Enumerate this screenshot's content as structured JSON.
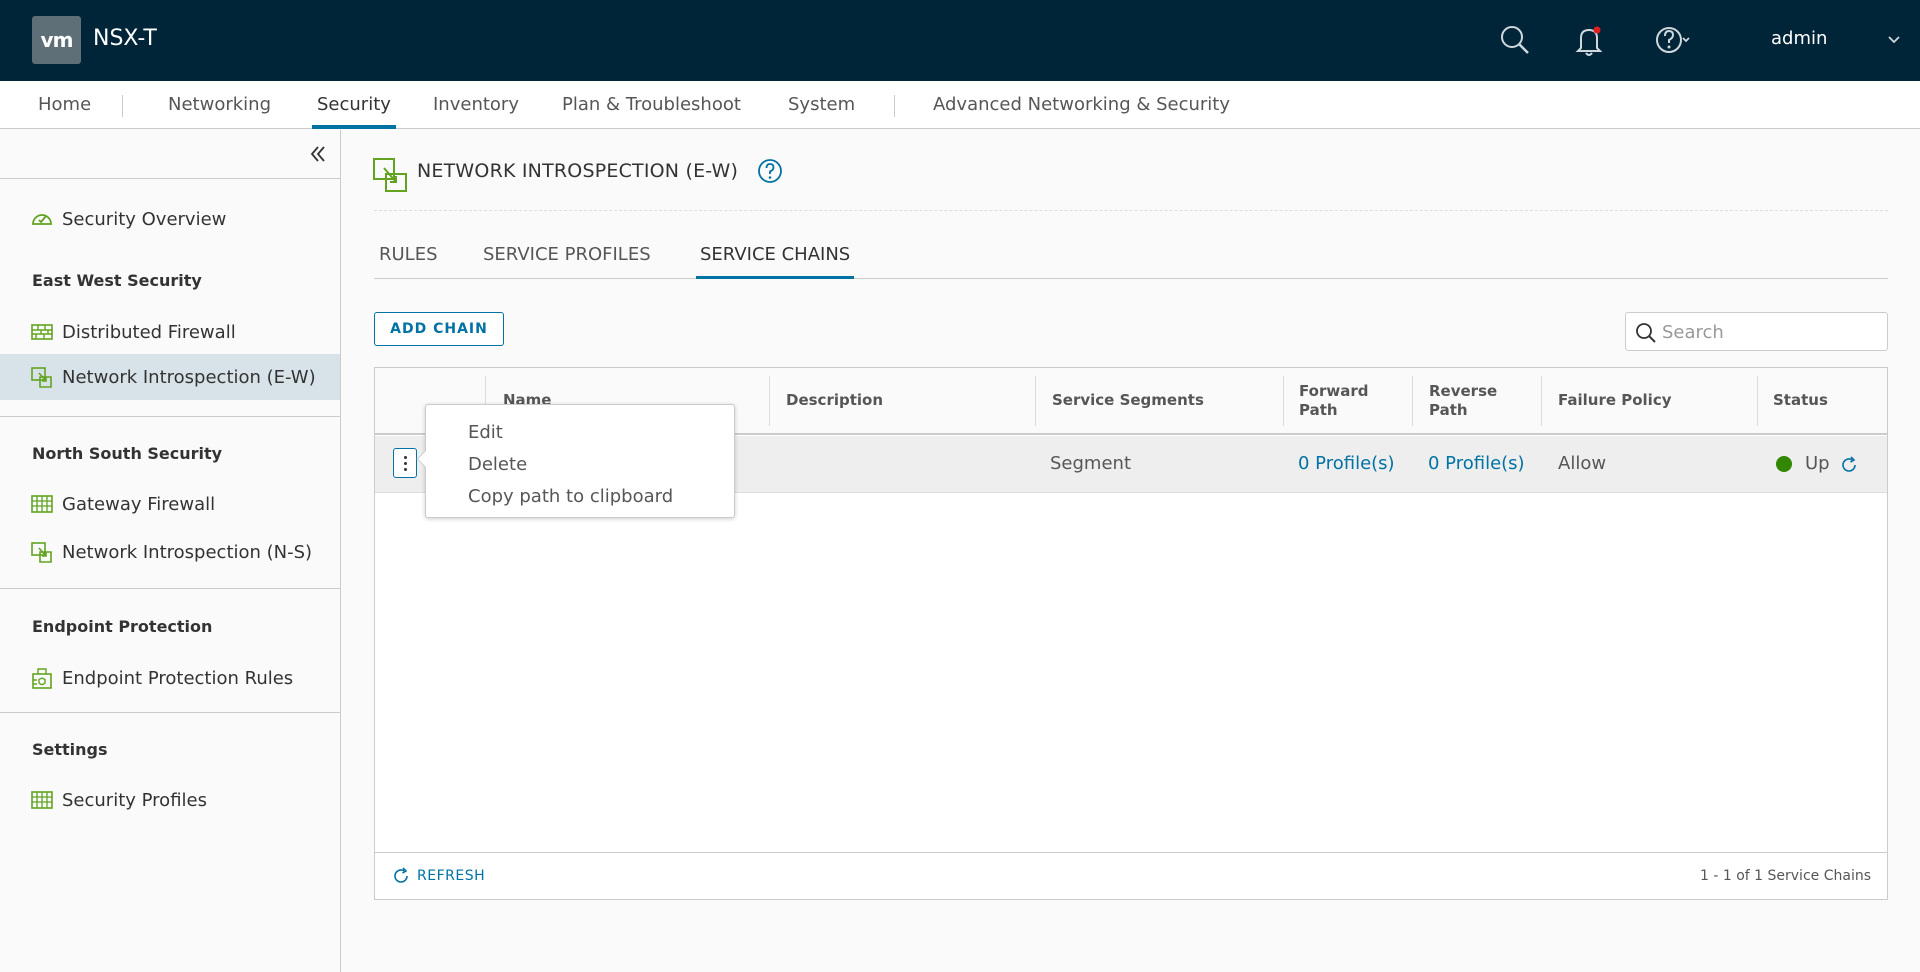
{
  "header": {
    "logo_text": "vm",
    "brand": "NSX-T",
    "user": "admin",
    "icons": [
      "search-icon",
      "bell-icon",
      "help-icon",
      "chevron-down-icon"
    ],
    "colors": {
      "background": "#002538",
      "notification_dot": "#e02020"
    }
  },
  "nav": {
    "items": [
      {
        "label": "Home"
      },
      {
        "label": "Networking"
      },
      {
        "label": "Security",
        "active": true
      },
      {
        "label": "Inventory"
      },
      {
        "label": "Plan & Troubleshoot"
      },
      {
        "label": "System"
      },
      {
        "label": "Advanced Networking & Security"
      }
    ],
    "accent": "#0072a3"
  },
  "sidebar": {
    "overview": {
      "label": "Security Overview",
      "icon": "gauge-icon"
    },
    "sections": [
      {
        "heading": "East West Security",
        "items": [
          {
            "label": "Distributed Firewall",
            "icon": "firewall-icon"
          },
          {
            "label": "Network Introspection (E-W)",
            "icon": "introspection-icon",
            "active": true
          }
        ]
      },
      {
        "heading": "North South Security",
        "items": [
          {
            "label": "Gateway Firewall",
            "icon": "gateway-firewall-icon"
          },
          {
            "label": "Network Introspection (N-S)",
            "icon": "introspection-icon"
          }
        ]
      },
      {
        "heading": "Endpoint Protection",
        "items": [
          {
            "label": "Endpoint Protection Rules",
            "icon": "endpoint-icon"
          }
        ]
      },
      {
        "heading": "Settings",
        "items": [
          {
            "label": "Security Profiles",
            "icon": "profiles-icon"
          }
        ]
      }
    ],
    "icon_color": "#62a420"
  },
  "main": {
    "title": "NETWORK INTROSPECTION (E-W)",
    "tabs": [
      {
        "label": "RULES"
      },
      {
        "label": "SERVICE PROFILES"
      },
      {
        "label": "SERVICE CHAINS",
        "active": true
      }
    ],
    "add_button": "ADD CHAIN",
    "search": {
      "placeholder": "Search",
      "value": ""
    },
    "grid": {
      "columns": [
        "Name",
        "Description",
        "Service Segments",
        "Forward Path",
        "Reverse Path",
        "Failure Policy",
        "Status"
      ],
      "rows": [
        {
          "name": "",
          "description": "",
          "service_segments": "Segment",
          "forward_path": "0 Profile(s)",
          "reverse_path": "0 Profile(s)",
          "failure_policy": "Allow",
          "status": "Up",
          "status_color": "#318700"
        }
      ],
      "refresh_label": "REFRESH",
      "pager": "1 - 1 of 1 Service Chains"
    },
    "context_menu": {
      "items": [
        "Edit",
        "Delete",
        "Copy path to clipboard"
      ]
    }
  }
}
